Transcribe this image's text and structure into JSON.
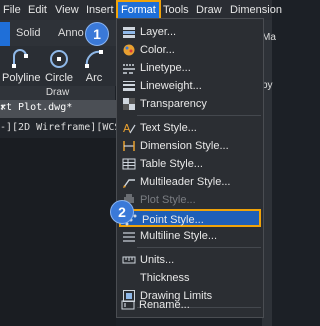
{
  "menubar": [
    "File",
    "Edit",
    "View",
    "Insert",
    "Format",
    "Tools",
    "Draw",
    "Dimension"
  ],
  "ribbon_tabs": [
    "Solid",
    "Anno"
  ],
  "ribbon_right": "Ma",
  "tools": [
    "Polyline",
    "Circle",
    "Arc"
  ],
  "panel_label": "Draw",
  "doc_tab": "rt Plot.dwg*",
  "doc_close": "✕",
  "viewport_label": "-][2D Wireframe][WCS]",
  "copy_label": "py",
  "menu": [
    {
      "label": "Layer...",
      "icon": "layer-icon"
    },
    {
      "label": "Color...",
      "icon": "color-icon"
    },
    {
      "label": "Linetype...",
      "icon": "linetype-icon"
    },
    {
      "label": "Lineweight...",
      "icon": "lineweight-icon"
    },
    {
      "label": "Transparency",
      "icon": "transparency-icon"
    },
    {
      "label": "Text Style...",
      "icon": "text-style-icon"
    },
    {
      "label": "Dimension Style...",
      "icon": "dimension-style-icon"
    },
    {
      "label": "Table Style...",
      "icon": "table-style-icon"
    },
    {
      "label": "Multileader Style...",
      "icon": "multileader-style-icon"
    },
    {
      "label": "Plot Style...",
      "icon": "plot-style-icon"
    },
    {
      "label": "Point Style...",
      "icon": "point-style-icon"
    },
    {
      "label": "Multiline Style...",
      "icon": "multiline-style-icon"
    },
    {
      "label": "Units...",
      "icon": "units-icon"
    },
    {
      "label": "Thickness",
      "icon": "thickness-icon"
    },
    {
      "label": "Drawing Limits",
      "icon": "drawing-limits-icon"
    },
    {
      "label": "Rename...",
      "icon": "rename-icon"
    }
  ],
  "badges": [
    "1",
    "2"
  ],
  "colors": {
    "accent": "#1f6fd8",
    "highlight_border": "#f0a30a",
    "badge": "#3a79d8"
  }
}
